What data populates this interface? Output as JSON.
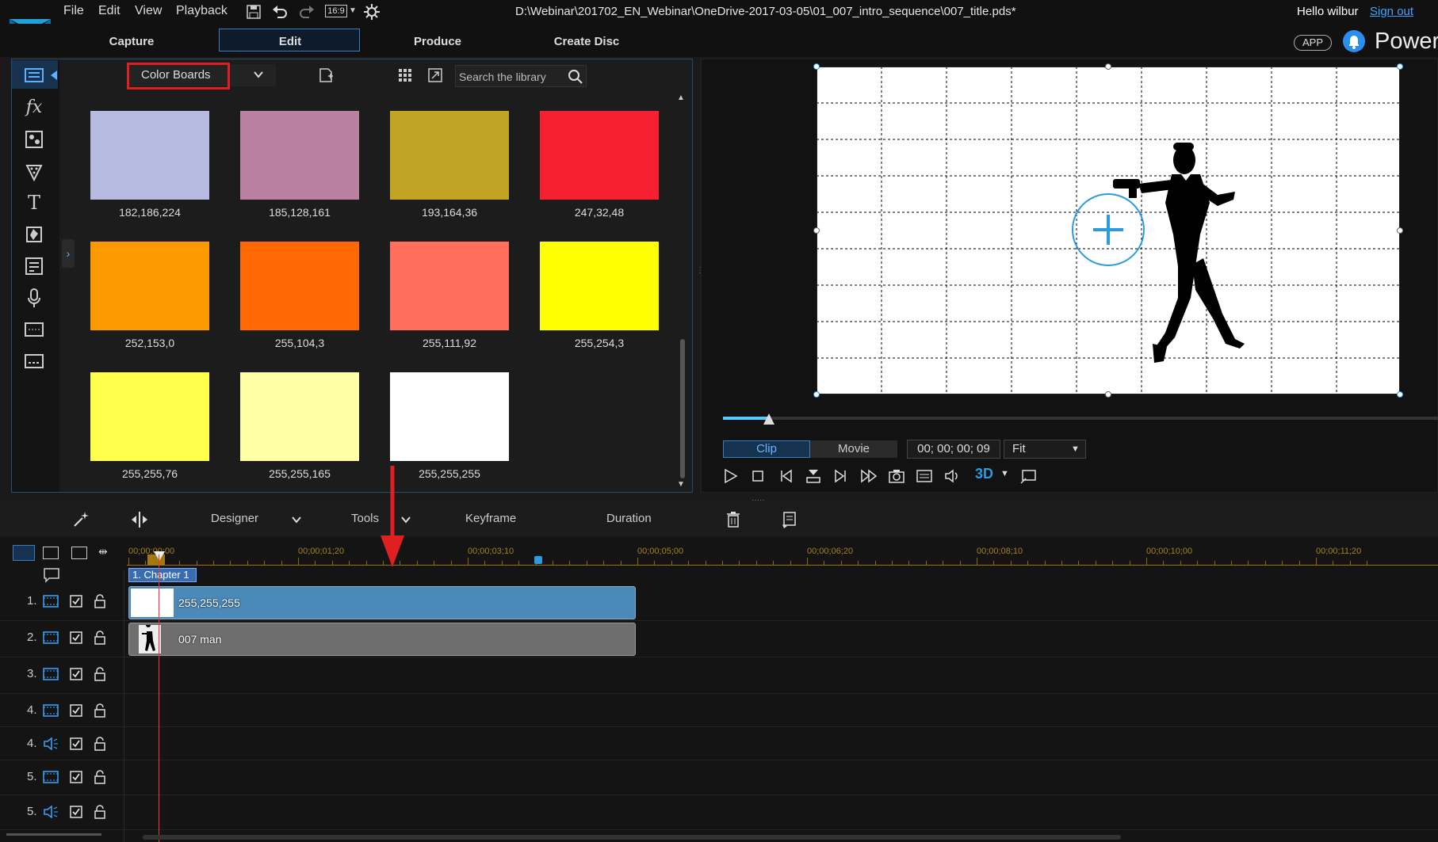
{
  "menu": {
    "file": "File",
    "edit": "Edit",
    "view": "View",
    "playback": "Playback",
    "aspect": "16:9"
  },
  "window": {
    "path": "D:\\Webinar\\201702_EN_Webinar\\OneDrive-2017-03-05\\01_007_intro_sequence\\007_title.pds*",
    "greeting": "Hello wilbur",
    "sign_out": "Sign out"
  },
  "modes": {
    "capture": "Capture",
    "edit": "Edit",
    "produce": "Produce",
    "create_disc": "Create Disc",
    "app_badge": "APP",
    "brand": "PowerD"
  },
  "library": {
    "category": "Color Boards",
    "search_placeholder": "Search the library",
    "swatches": [
      {
        "label": "182,186,224",
        "color": "#b6bae0"
      },
      {
        "label": "185,128,161",
        "color": "#b980a1"
      },
      {
        "label": "193,164,36",
        "color": "#c1a424"
      },
      {
        "label": "247,32,48",
        "color": "#f72030"
      },
      {
        "label": "252,153,0",
        "color": "#fc9900"
      },
      {
        "label": "255,104,3",
        "color": "#ff6803"
      },
      {
        "label": "255,111,92",
        "color": "#ff6f5c"
      },
      {
        "label": "255,254,3",
        "color": "#fffe03"
      },
      {
        "label": "255,255,76",
        "color": "#ffff4c"
      },
      {
        "label": "255,255,165",
        "color": "#ffffa5"
      },
      {
        "label": "255,255,255",
        "color": "#ffffff"
      }
    ]
  },
  "preview": {
    "clip": "Clip",
    "movie": "Movie",
    "timecode": "00; 00; 00; 09",
    "zoom": "Fit",
    "mode_3d": "3D",
    "progress": 0.064
  },
  "toolbar": {
    "designer": "Designer",
    "tools": "Tools",
    "keyframe": "Keyframe",
    "duration": "Duration"
  },
  "timeline": {
    "ticks": [
      "00;00;00;00",
      "00;00;01;20",
      "00;00;03;10",
      "00;00;05;00",
      "00;00;06;20",
      "00;00;08;10",
      "00;00;10;00",
      "00;00;11;20"
    ],
    "chapter": "1. Chapter 1",
    "tracks": [
      {
        "num": "1.",
        "type": "video"
      },
      {
        "num": "2.",
        "type": "video"
      },
      {
        "num": "3.",
        "type": "video"
      },
      {
        "num": "4.",
        "type": "video"
      },
      {
        "num": "4.",
        "type": "audio"
      },
      {
        "num": "5.",
        "type": "video"
      },
      {
        "num": "5.",
        "type": "audio"
      }
    ],
    "clips": [
      {
        "label": "255,255,255"
      },
      {
        "label": "007 man"
      }
    ]
  }
}
